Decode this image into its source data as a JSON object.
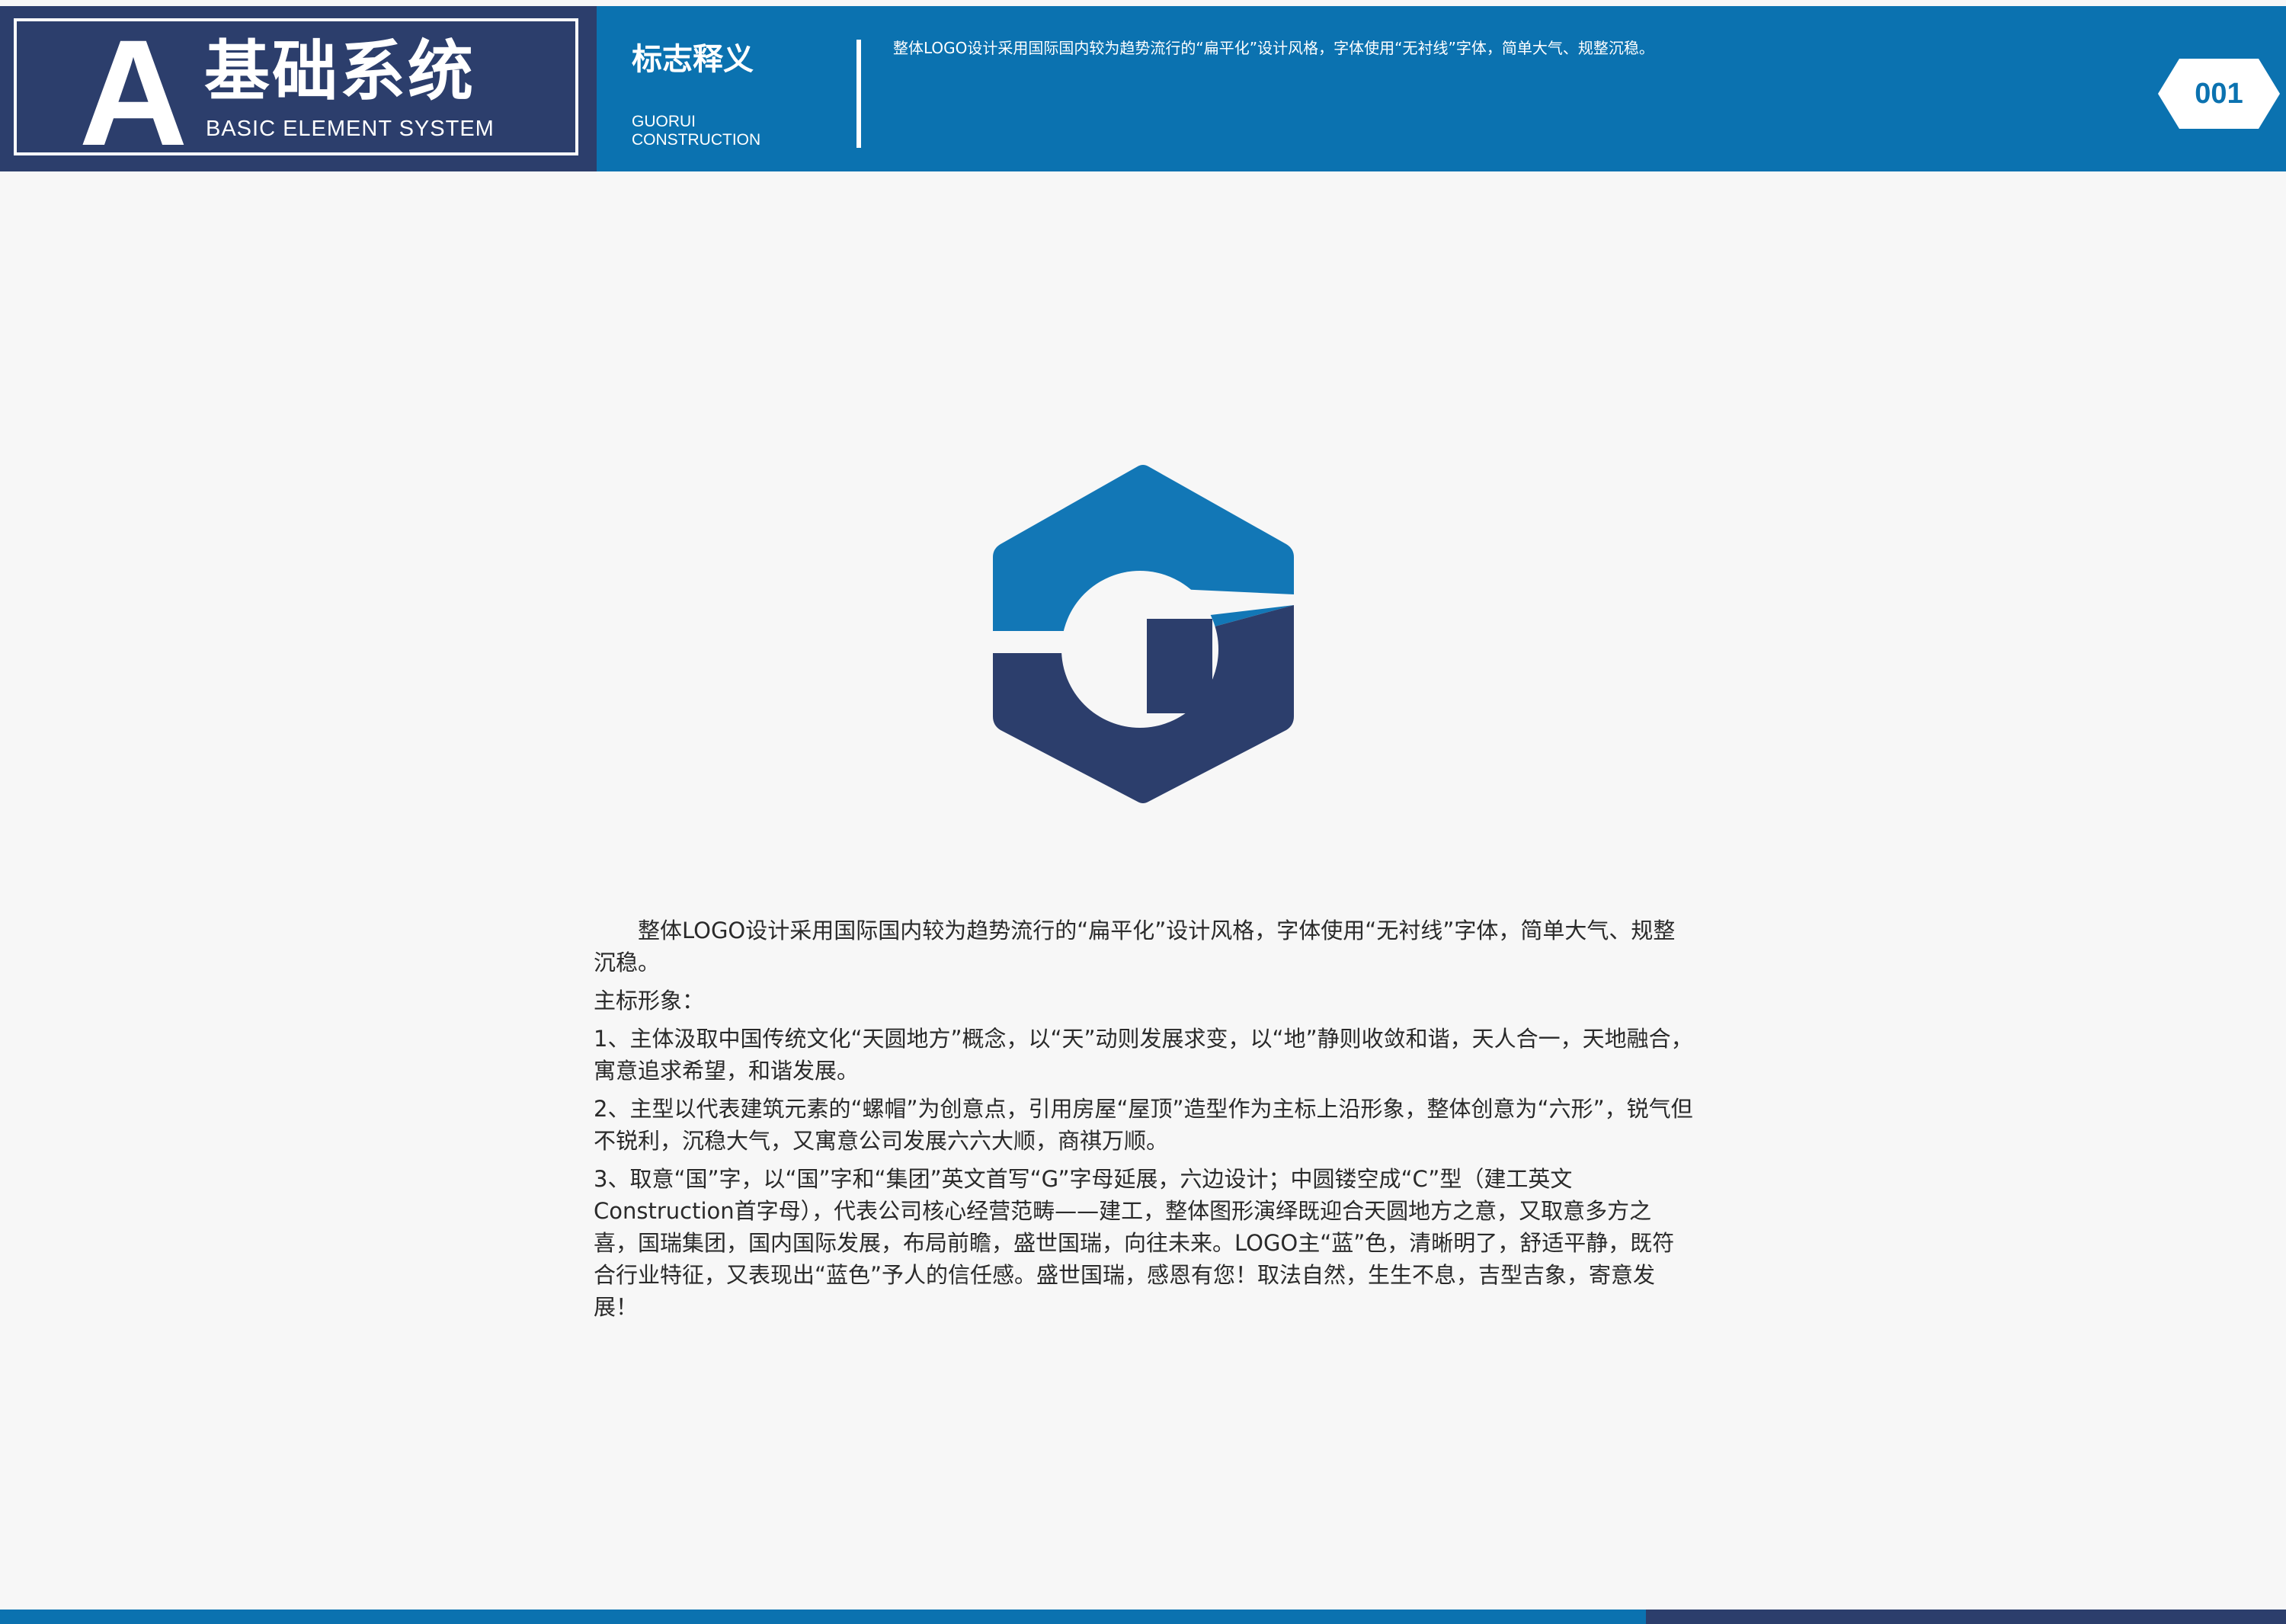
{
  "header": {
    "brand_letter": "A",
    "brand_title": "基础系统",
    "brand_subtitle": "BASIC ELEMENT SYSTEM",
    "section_title": "标志释义",
    "section_subtitle": "GUORUI\nCONSTRUCTION",
    "description": "整体LOGO设计采用国际国内较为趋势流行的“扁平化”设计风格，字体使用“无衬线”字体，简单大气、规整沉稳。",
    "page_number": "001"
  },
  "colors": {
    "primary_blue": "#0b72b0",
    "navy": "#2c3e6c",
    "background": "#f7f7f7"
  },
  "logo": {
    "icon": "hexagon-g-logo-icon"
  },
  "body": {
    "paragraphs": [
      "整体LOGO设计采用国际国内较为趋势流行的“扁平化”设计风格，字体使用“无衬线”字体，简单大气、规整沉稳。",
      "主标形象：",
      "1、主体汲取中国传统文化“天圆地方”概念，以“天”动则发展求变，以“地”静则收敛和谐，天人合一，天地融合，寓意追求希望，和谐发展。",
      "2、主型以代表建筑元素的“螺帽”为创意点，引用房屋“屋顶”造型作为主标上沿形象，整体创意为“六形”，锐气但不锐利，沉稳大气，又寓意公司发展六六大顺，商祺万顺。",
      "3、取意“国”字，以“国”字和“集团”英文首写“G”字母延展，六边设计；中圆镂空成“C”型（建工英文Construction首字母），代表公司核心经营范畴——建工，整体图形演绎既迎合天圆地方之意，又取意多方之喜，国瑞集团，国内国际发展，布局前瞻，盛世国瑞，向往未来。LOGO主“蓝”色，清晰明了，舒适平静，既符合行业特征，又表现出“蓝色”予人的信任感。盛世国瑞，感恩有您！取法自然，生生不息，吉型吉象，寄意发展！"
    ]
  }
}
